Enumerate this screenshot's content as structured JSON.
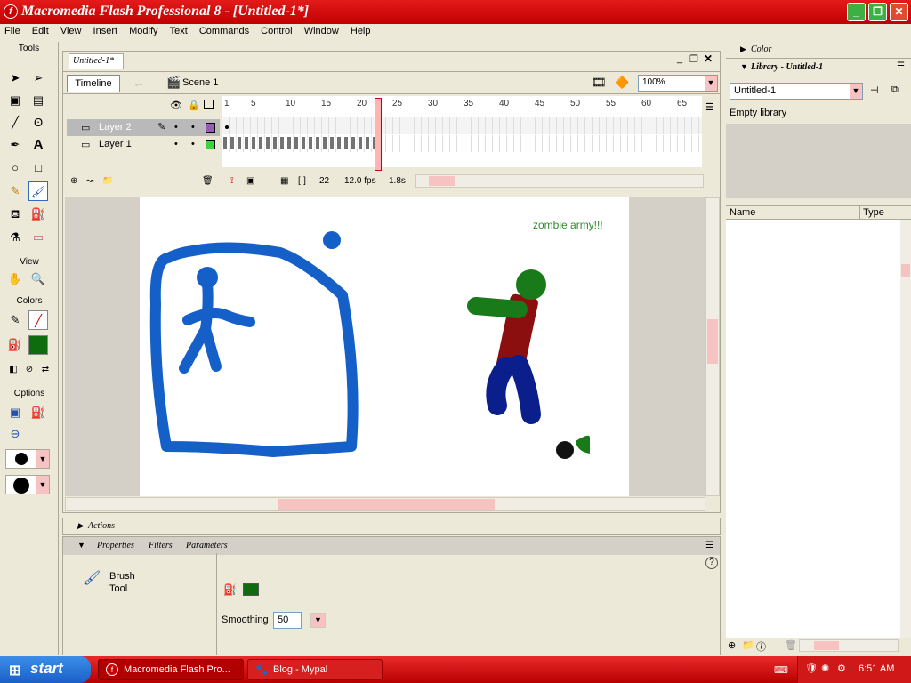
{
  "window": {
    "title": "Macromedia Flash Professional 8 - [Untitled-1*]",
    "app_icon": "flash-icon",
    "controls": [
      "minimize",
      "maximize",
      "close"
    ]
  },
  "menu": [
    "File",
    "Edit",
    "View",
    "Insert",
    "Modify",
    "Text",
    "Commands",
    "Control",
    "Window",
    "Help"
  ],
  "toolbox": {
    "title": "Tools",
    "view_label": "View",
    "colors_label": "Colors",
    "options_label": "Options",
    "stroke_color": "#cc0000",
    "fill_color": "#0e6b0e",
    "selected_tool": "brush"
  },
  "document": {
    "tab": "Untitled-1*",
    "timeline_button": "Timeline",
    "scene_label": "Scene 1",
    "zoom": "100%",
    "layers": [
      {
        "name": "Layer 2",
        "color": "#9b59b6",
        "selected": true
      },
      {
        "name": "Layer 1",
        "color": "#3cd63c",
        "selected": false
      }
    ],
    "frame_numbers": [
      "1",
      "5",
      "10",
      "15",
      "20",
      "25",
      "30",
      "35",
      "40",
      "45",
      "50",
      "55",
      "60",
      "65"
    ],
    "current_frame": "22",
    "fps": "12.0 fps",
    "elapsed": "1.8s",
    "stage_text": "zombie army!!!"
  },
  "actions_panel": {
    "title": "Actions"
  },
  "properties_panel": {
    "tabs": [
      "Properties",
      "Filters",
      "Parameters"
    ],
    "tool_name": "Brush",
    "tool_sub": "Tool",
    "smoothing_label": "Smoothing",
    "smoothing_value": "50",
    "fill_color": "#0e6b0e"
  },
  "right_panels": {
    "color_title": "Color",
    "library_title": "Library - Untitled-1",
    "library_doc": "Untitled-1",
    "library_status": "Empty library",
    "col_name": "Name",
    "col_type": "Type"
  },
  "taskbar": {
    "start": "start",
    "tasks": [
      "Macromedia Flash Pro...",
      "Blog - Mypal"
    ],
    "clock": "6:51 AM"
  }
}
